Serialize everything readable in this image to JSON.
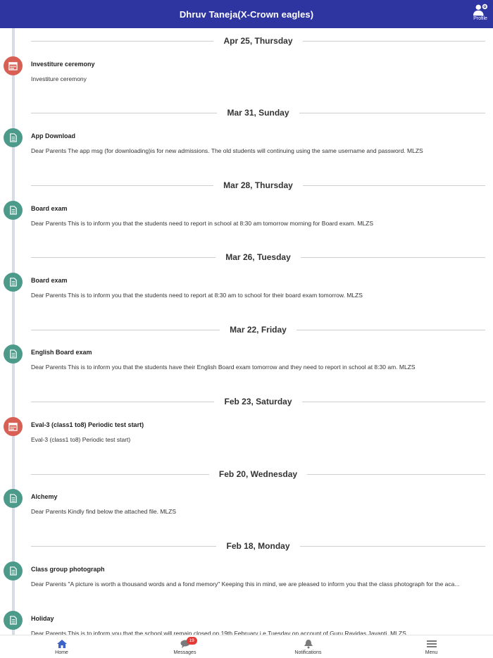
{
  "header": {
    "title": "Dhruv Taneja(X-Crown eagles)",
    "profile_label": "Profile"
  },
  "colors": {
    "header_bg": "#2e35a1",
    "event_icon": "#d75f53",
    "notice_icon": "#4c9b8a",
    "badge": "#e53935"
  },
  "feed": [
    {
      "date": "Apr 25, Thursday",
      "icon": "calendar-icon",
      "title": "Investiture ceremony",
      "body": "Investiture ceremony"
    },
    {
      "date": "Mar 31, Sunday",
      "icon": "document-icon",
      "title": "App Download",
      "body": "Dear Parents The app msg (for downloading)is for new admissions.   The old students will continuing using the same username and password. MLZS"
    },
    {
      "date": "Mar 28, Thursday",
      "icon": "document-icon",
      "title": "Board exam",
      "body": "Dear Parents This is to inform you that the students need to report in school at 8:30 am tomorrow morning for Board exam. MLZS"
    },
    {
      "date": "Mar 26, Tuesday",
      "icon": "document-icon",
      "title": "Board exam",
      "body": "Dear Parents This is to inform you that the students need to report at 8:30 am to school for their board exam tomorrow. MLZS"
    },
    {
      "date": "Mar 22, Friday",
      "icon": "document-icon",
      "title": "English Board exam",
      "body": "Dear Parents This is to inform you that the students have their English Board exam tomorrow and they need to report in school at 8:30 am. MLZS"
    },
    {
      "date": "Feb 23, Saturday",
      "icon": "calendar-icon",
      "title": "Eval-3 (class1 to8) Periodic test start)",
      "body": "Eval-3 (class1 to8) Periodic test start)"
    },
    {
      "date": "Feb 20, Wednesday",
      "icon": "document-icon",
      "title": "Alchemy",
      "body": "Dear Parents Kindly find below the attached file. MLZS"
    },
    {
      "date": "Feb 18, Monday",
      "icon": "document-icon",
      "title": "Class group photograph",
      "body": "Dear Parents \"A picture is worth a thousand words and a fond memory\" Keeping this in mind, we are pleased to inform you that the class photograph for the aca..."
    },
    {
      "date": "",
      "icon": "document-icon",
      "title": "Holiday",
      "body": "Dear Parents This is to inform you that the school will remain closed on 19th February i.e Tuesday on account of Guru Ravidas Jayanti. MLZS"
    }
  ],
  "bottom_nav": {
    "home": "Home",
    "messages": "Messages",
    "messages_badge": "19",
    "notifications": "Notifications",
    "menu": "Menu"
  }
}
